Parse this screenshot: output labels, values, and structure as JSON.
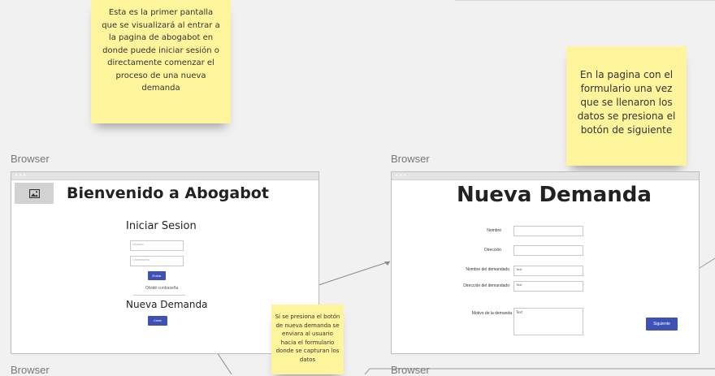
{
  "sticky_notes": {
    "note1": "Esta es la primer pantalla que se visualizará al entrar a la pagina de abogabot en donde puede iniciar sesión o directamente comenzar el proceso de una nueva demanda",
    "note2": "En la pagina con el formulario una vez que se llenaron los datos se presiona el botón de siguiente",
    "note3": "Si se presiona el botón de nueva demanda se enviara al usuario hacia el formulario donde se capturan los datos"
  },
  "browser_label": "Browser",
  "screen1": {
    "title": "Bienvenido a Abogabot",
    "login_heading": "Iniciar Sesion",
    "user_placeholder": "Usuario",
    "password_placeholder": "Contraseña",
    "login_button": "Entrar",
    "forgot_text": "Olvidé contraseña",
    "new_demand_heading": "Nueva Demanda",
    "new_demand_button": "Crear"
  },
  "screen2": {
    "title": "Nueva Demanda",
    "fields": [
      {
        "label": "Nombre",
        "value": ""
      },
      {
        "label": "Dirección",
        "value": ""
      },
      {
        "label": "Nombre del demandado",
        "value": "Text"
      },
      {
        "label": "Dirección del demandado",
        "value": "Text"
      }
    ],
    "reason_label": "Motivo de la demanda",
    "reason_value": "Text",
    "next_button": "Siguiente"
  },
  "icons": {
    "image_placeholder": "image-icon"
  },
  "colors": {
    "sticky": "#fef49c",
    "button": "#3f51b5",
    "canvas": "#f1f1f1"
  }
}
